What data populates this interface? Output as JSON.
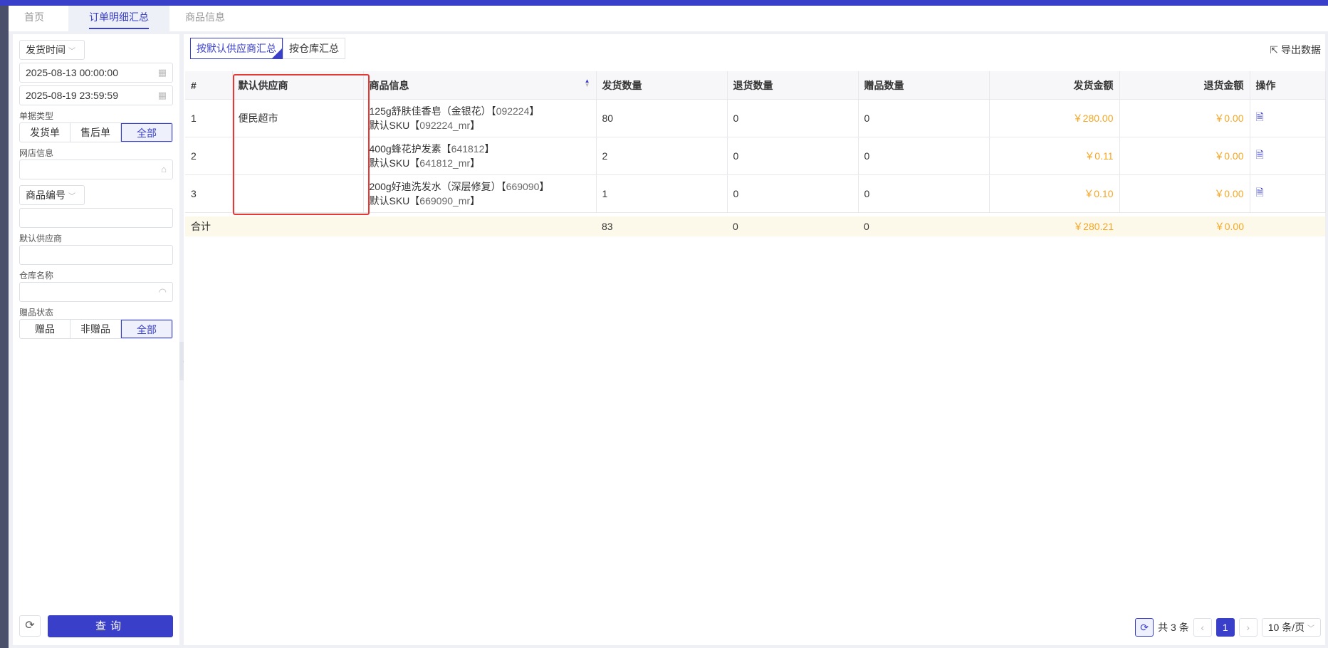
{
  "tabs": [
    {
      "label": "首页",
      "active": false
    },
    {
      "label": "订单明细汇总",
      "active": true
    },
    {
      "label": "商品信息",
      "active": false
    }
  ],
  "filters": {
    "time_type": "发货时间",
    "start_time": "2025-08-13 00:00:00",
    "end_time": "2025-08-19 23:59:59",
    "doc_type_label": "单据类型",
    "doc_types": [
      "发货单",
      "售后单",
      "全部"
    ],
    "doc_type_selected": "全部",
    "shop_label": "网店信息",
    "shop_value": "",
    "goods_code_type": "商品编号",
    "goods_code_value": "",
    "supplier_label": "默认供应商",
    "supplier_value": "",
    "warehouse_label": "仓库名称",
    "warehouse_value": "",
    "gift_label": "赠品状态",
    "gift_options": [
      "赠品",
      "非赠品",
      "全部"
    ],
    "gift_selected": "全部",
    "query_label": "查询"
  },
  "mode_tabs": [
    "按默认供应商汇总",
    "按仓库汇总"
  ],
  "export_label": "导出数据",
  "table": {
    "columns": [
      "#",
      "默认供应商",
      "商品信息",
      "发货数量",
      "退货数量",
      "赠品数量",
      "发货金额",
      "退货金额",
      "操作"
    ],
    "rows": [
      {
        "idx": "1",
        "supplier": "便民超市",
        "goods_name": "125g舒肤佳香皂（金银花）【",
        "goods_code": "092224",
        "goods_close": "】",
        "sku_prefix": "默认SKU【",
        "sku_code": "092224_mr",
        "sku_close": "】",
        "ship_qty": "80",
        "return_qty": "0",
        "gift_qty": "0",
        "ship_amt": "￥280.00",
        "return_amt": "￥0.00"
      },
      {
        "idx": "2",
        "supplier": "",
        "goods_name": "400g蜂花护发素【",
        "goods_code": "641812",
        "goods_close": "】",
        "sku_prefix": "默认SKU【",
        "sku_code": "641812_mr",
        "sku_close": "】",
        "ship_qty": "2",
        "return_qty": "0",
        "gift_qty": "0",
        "ship_amt": "￥0.11",
        "return_amt": "￥0.00"
      },
      {
        "idx": "3",
        "supplier": "",
        "goods_name": "200g好迪洗发水（深层修复）【",
        "goods_code": "669090",
        "goods_close": "】",
        "sku_prefix": "默认SKU【",
        "sku_code": "669090_mr",
        "sku_close": "】",
        "ship_qty": "1",
        "return_qty": "0",
        "gift_qty": "0",
        "ship_amt": "￥0.10",
        "return_amt": "￥0.00"
      }
    ],
    "total": {
      "label": "合计",
      "ship_qty": "83",
      "return_qty": "0",
      "gift_qty": "0",
      "ship_amt": "￥280.21",
      "return_amt": "￥0.00"
    }
  },
  "pager": {
    "total_text": "共 3 条",
    "current_page": "1",
    "page_size": "10 条/页"
  },
  "colors": {
    "accent": "#3a3fc9",
    "money": "#f5a623",
    "highlight_box": "#e53935"
  }
}
